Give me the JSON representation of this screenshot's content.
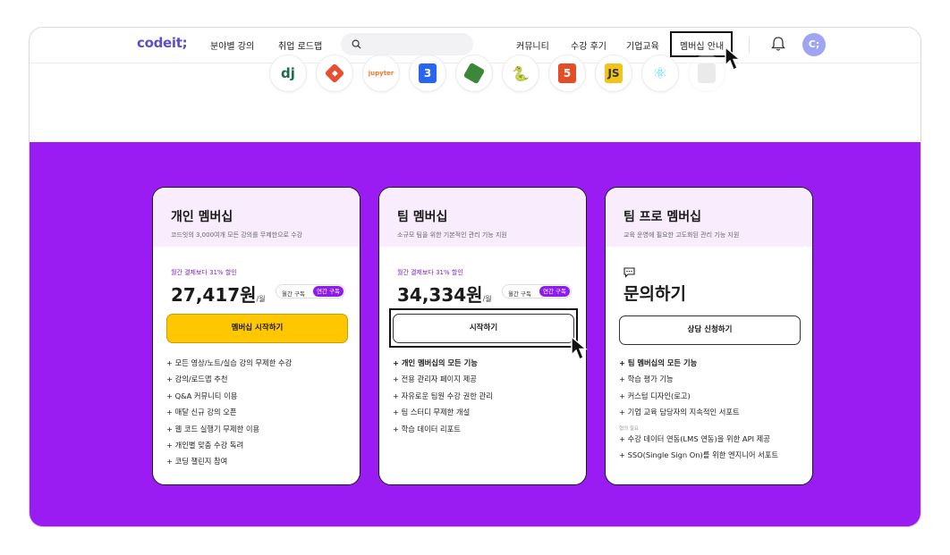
{
  "nav": {
    "logo": "codeit;",
    "links": [
      "분야별 강의",
      "취업 로드맵"
    ],
    "search_placeholder": "",
    "right_links": [
      "커뮤니티",
      "수강 후기",
      "기업교육",
      "멤버십 안내"
    ],
    "avatar_initial": "C;"
  },
  "tech_icons": [
    "django-icon",
    "git-icon",
    "jupyter-icon",
    "css3-icon",
    "nodejs-icon",
    "python-icon",
    "html5-icon",
    "javascript-icon",
    "react-icon",
    "faded-icon"
  ],
  "plans": [
    {
      "title": "개인 멤버십",
      "desc": "코드잇의 3,000여개 모든 강의를 무제한으로 수강",
      "discount": "월간 결제보다 31% 할인",
      "price": "27,417원",
      "unit": "/월",
      "toggle_monthly": "월간 구독",
      "toggle_yearly": "연간 구독",
      "button": "멤버십 시작하기",
      "features": [
        "+ 모든 영상/노트/실습 강의 무제한 수강",
        "+ 강의/로드맵 추천",
        "+ Q&A 커뮤니티 이용",
        "+ 매달 신규 강의 오픈",
        "+ 웹 코드 실행기 무제한 이용",
        "+ 개인별 맞춤 수강 독려",
        "+ 코딩 챌린지 참여"
      ]
    },
    {
      "title": "팀 멤버십",
      "desc": "소규모 팀을 위한 기본적인 관리 기능 지원",
      "discount": "월간 결제보다 31% 할인",
      "price": "34,334원",
      "unit": "/월",
      "toggle_monthly": "월간 구독",
      "toggle_yearly": "연간 구독",
      "button": "시작하기",
      "features": [
        "+ 개인 멤버십의 모든 기능",
        "+ 전용 관리자 페이지 제공",
        "+ 자유로운 팀원 수강 권한 관리",
        "+ 팀 스터디 무제한 개설",
        "+ 학습 데이터 리포트"
      ]
    },
    {
      "title": "팀 프로 멤버십",
      "desc": "교육 운영에 필요한 고도화된 관리 기능 지원",
      "contact": "문의하기",
      "button": "상담 신청하기",
      "features": [
        "+ 팀 멤버십의 모든 기능",
        "+ 학습 평가 기능",
        "+ 커스텀 디자인(로고)",
        "+ 기업 교육 담당자의 지속적인 서포트"
      ],
      "note": "협의 필요",
      "features_extra": [
        "+ 수강 데이터 연동(LMS 연동)을 위한 API 제공",
        "+ SSO(Single Sign On)를 위한 엔지니어 서포트"
      ]
    }
  ],
  "colors": {
    "purple": "#9a1cf2",
    "yellow": "#ffc700",
    "brand": "#5a4fd1",
    "card_head": "#f8ecfd"
  }
}
